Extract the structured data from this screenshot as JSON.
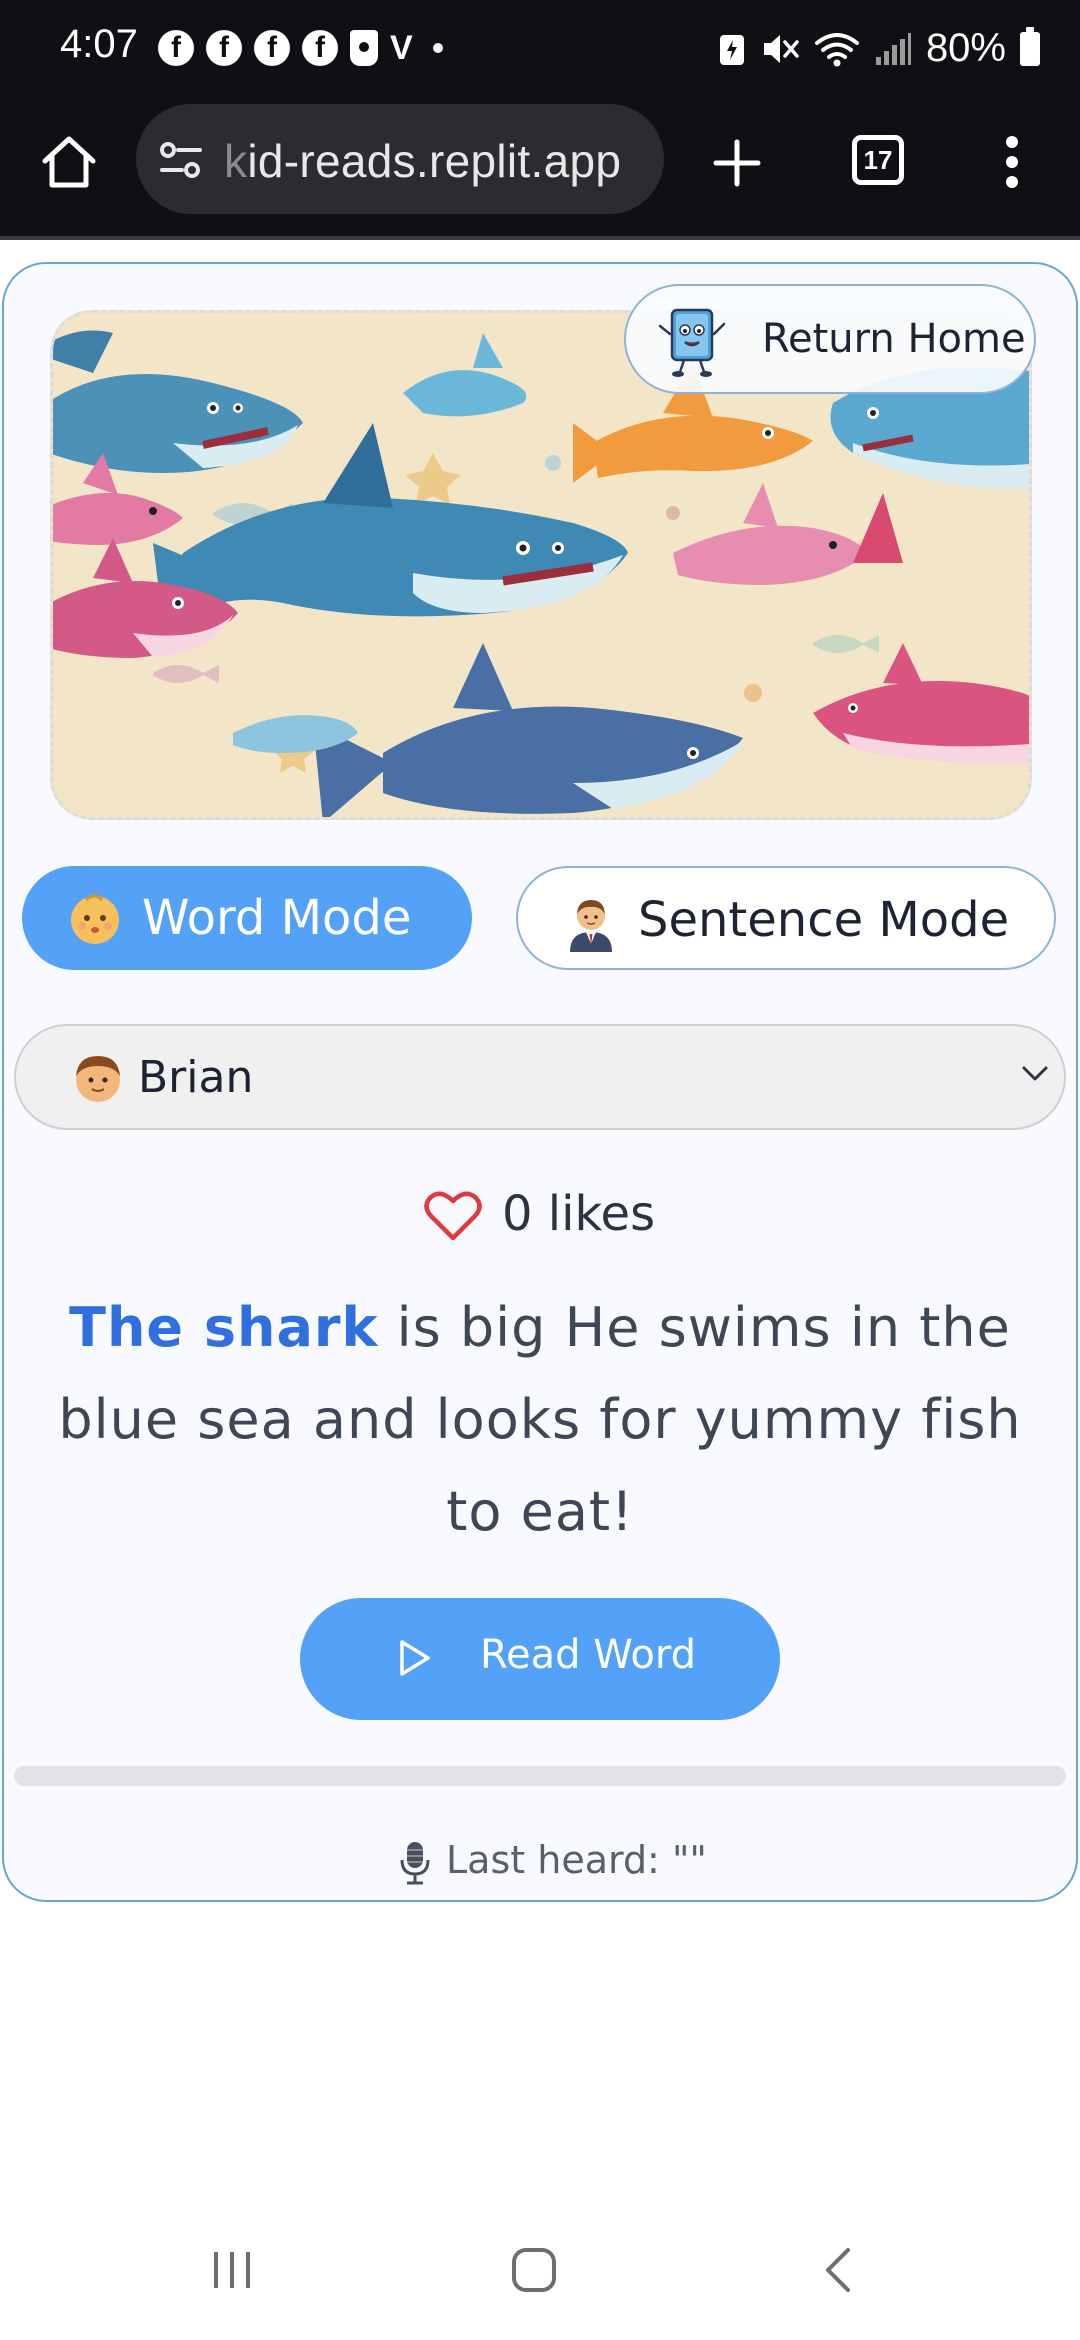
{
  "status_bar": {
    "time": "4:07",
    "notification_icons": [
      "facebook-icon",
      "facebook-icon",
      "facebook-icon",
      "facebook-icon",
      "cup-icon",
      "v-icon",
      "dot-icon"
    ],
    "facebook_glyph": "f",
    "v_glyph": "V",
    "battery_percent": "80%",
    "system_icons": [
      "battery-saver-icon",
      "mute-icon",
      "wifi-icon",
      "signal-icon",
      "battery-icon"
    ]
  },
  "browser": {
    "url_faded_char": "k",
    "url": "id-reads.replit.app",
    "tabs_count": "17"
  },
  "hero": {
    "image": "sharks-illustration"
  },
  "return_home": {
    "label": "Return Home"
  },
  "modes": {
    "word_label": "Word Mode",
    "sentence_label": "Sentence Mode",
    "selected": "Word Mode"
  },
  "user_select": {
    "value": "Brian"
  },
  "likes": {
    "label": "0 likes"
  },
  "story": {
    "highlight": "The shark",
    "rest": " is big He swims in the blue sea and looks for yummy fish to eat!"
  },
  "read_button": {
    "label": "Read Word"
  },
  "progress": {
    "fraction": 0
  },
  "last_heard": {
    "label": "Last heard: \"\""
  },
  "colors": {
    "accent": "#54a2f7",
    "highlight_text": "#2f6fe0",
    "heart": "#e0393e",
    "card_border": "#6aa3d8",
    "status_bg": "#0f1013"
  }
}
